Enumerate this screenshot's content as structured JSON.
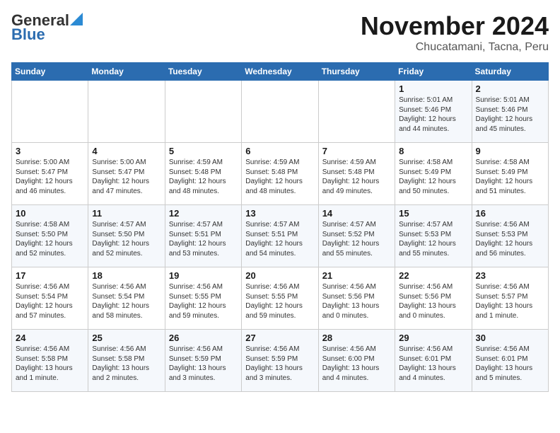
{
  "header": {
    "logo_general": "General",
    "logo_blue": "Blue",
    "month_title": "November 2024",
    "location": "Chucatamani, Tacna, Peru"
  },
  "weekdays": [
    "Sunday",
    "Monday",
    "Tuesday",
    "Wednesday",
    "Thursday",
    "Friday",
    "Saturday"
  ],
  "weeks": [
    [
      {
        "day": "",
        "info": ""
      },
      {
        "day": "",
        "info": ""
      },
      {
        "day": "",
        "info": ""
      },
      {
        "day": "",
        "info": ""
      },
      {
        "day": "",
        "info": ""
      },
      {
        "day": "1",
        "info": "Sunrise: 5:01 AM\nSunset: 5:46 PM\nDaylight: 12 hours\nand 44 minutes."
      },
      {
        "day": "2",
        "info": "Sunrise: 5:01 AM\nSunset: 5:46 PM\nDaylight: 12 hours\nand 45 minutes."
      }
    ],
    [
      {
        "day": "3",
        "info": "Sunrise: 5:00 AM\nSunset: 5:47 PM\nDaylight: 12 hours\nand 46 minutes."
      },
      {
        "day": "4",
        "info": "Sunrise: 5:00 AM\nSunset: 5:47 PM\nDaylight: 12 hours\nand 47 minutes."
      },
      {
        "day": "5",
        "info": "Sunrise: 4:59 AM\nSunset: 5:48 PM\nDaylight: 12 hours\nand 48 minutes."
      },
      {
        "day": "6",
        "info": "Sunrise: 4:59 AM\nSunset: 5:48 PM\nDaylight: 12 hours\nand 48 minutes."
      },
      {
        "day": "7",
        "info": "Sunrise: 4:59 AM\nSunset: 5:48 PM\nDaylight: 12 hours\nand 49 minutes."
      },
      {
        "day": "8",
        "info": "Sunrise: 4:58 AM\nSunset: 5:49 PM\nDaylight: 12 hours\nand 50 minutes."
      },
      {
        "day": "9",
        "info": "Sunrise: 4:58 AM\nSunset: 5:49 PM\nDaylight: 12 hours\nand 51 minutes."
      }
    ],
    [
      {
        "day": "10",
        "info": "Sunrise: 4:58 AM\nSunset: 5:50 PM\nDaylight: 12 hours\nand 52 minutes."
      },
      {
        "day": "11",
        "info": "Sunrise: 4:57 AM\nSunset: 5:50 PM\nDaylight: 12 hours\nand 52 minutes."
      },
      {
        "day": "12",
        "info": "Sunrise: 4:57 AM\nSunset: 5:51 PM\nDaylight: 12 hours\nand 53 minutes."
      },
      {
        "day": "13",
        "info": "Sunrise: 4:57 AM\nSunset: 5:51 PM\nDaylight: 12 hours\nand 54 minutes."
      },
      {
        "day": "14",
        "info": "Sunrise: 4:57 AM\nSunset: 5:52 PM\nDaylight: 12 hours\nand 55 minutes."
      },
      {
        "day": "15",
        "info": "Sunrise: 4:57 AM\nSunset: 5:53 PM\nDaylight: 12 hours\nand 55 minutes."
      },
      {
        "day": "16",
        "info": "Sunrise: 4:56 AM\nSunset: 5:53 PM\nDaylight: 12 hours\nand 56 minutes."
      }
    ],
    [
      {
        "day": "17",
        "info": "Sunrise: 4:56 AM\nSunset: 5:54 PM\nDaylight: 12 hours\nand 57 minutes."
      },
      {
        "day": "18",
        "info": "Sunrise: 4:56 AM\nSunset: 5:54 PM\nDaylight: 12 hours\nand 58 minutes."
      },
      {
        "day": "19",
        "info": "Sunrise: 4:56 AM\nSunset: 5:55 PM\nDaylight: 12 hours\nand 59 minutes."
      },
      {
        "day": "20",
        "info": "Sunrise: 4:56 AM\nSunset: 5:55 PM\nDaylight: 12 hours\nand 59 minutes."
      },
      {
        "day": "21",
        "info": "Sunrise: 4:56 AM\nSunset: 5:56 PM\nDaylight: 13 hours\nand 0 minutes."
      },
      {
        "day": "22",
        "info": "Sunrise: 4:56 AM\nSunset: 5:56 PM\nDaylight: 13 hours\nand 0 minutes."
      },
      {
        "day": "23",
        "info": "Sunrise: 4:56 AM\nSunset: 5:57 PM\nDaylight: 13 hours\nand 1 minute."
      }
    ],
    [
      {
        "day": "24",
        "info": "Sunrise: 4:56 AM\nSunset: 5:58 PM\nDaylight: 13 hours\nand 1 minute."
      },
      {
        "day": "25",
        "info": "Sunrise: 4:56 AM\nSunset: 5:58 PM\nDaylight: 13 hours\nand 2 minutes."
      },
      {
        "day": "26",
        "info": "Sunrise: 4:56 AM\nSunset: 5:59 PM\nDaylight: 13 hours\nand 3 minutes."
      },
      {
        "day": "27",
        "info": "Sunrise: 4:56 AM\nSunset: 5:59 PM\nDaylight: 13 hours\nand 3 minutes."
      },
      {
        "day": "28",
        "info": "Sunrise: 4:56 AM\nSunset: 6:00 PM\nDaylight: 13 hours\nand 4 minutes."
      },
      {
        "day": "29",
        "info": "Sunrise: 4:56 AM\nSunset: 6:01 PM\nDaylight: 13 hours\nand 4 minutes."
      },
      {
        "day": "30",
        "info": "Sunrise: 4:56 AM\nSunset: 6:01 PM\nDaylight: 13 hours\nand 5 minutes."
      }
    ]
  ]
}
